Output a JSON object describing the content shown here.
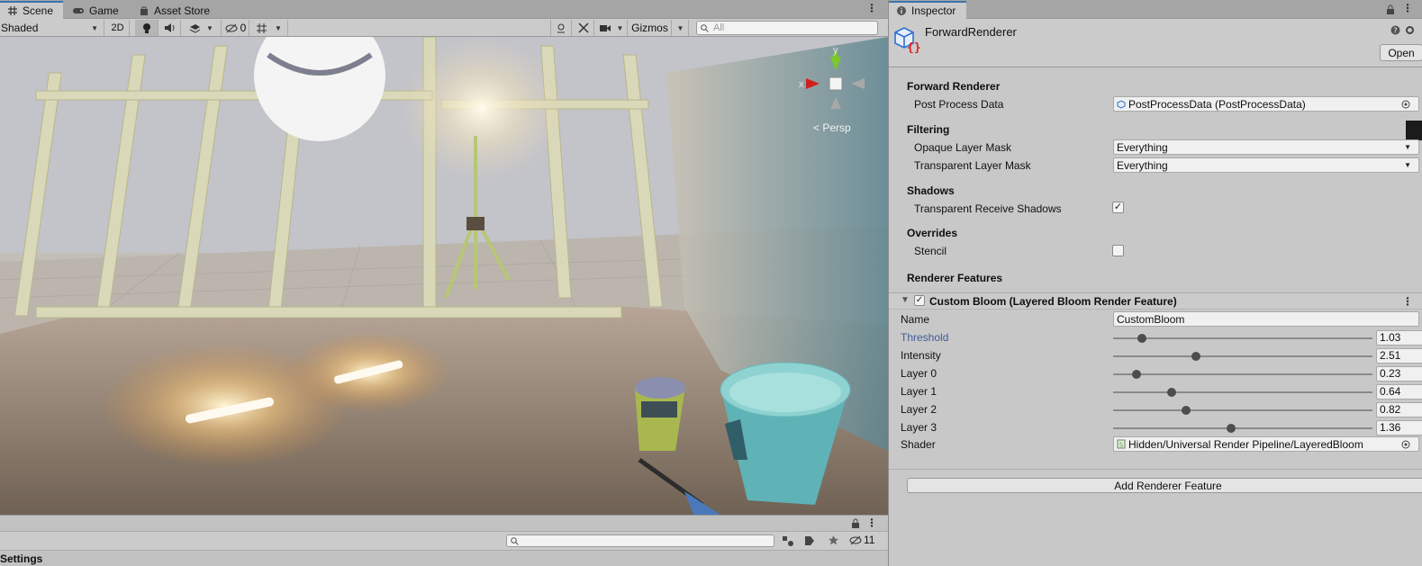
{
  "scene_window": {
    "tabs": [
      {
        "label": "Scene",
        "icon": "hash-icon",
        "active": true
      },
      {
        "label": "Game",
        "icon": "gamepad-icon",
        "active": false
      },
      {
        "label": "Asset Store",
        "icon": "bag-icon",
        "active": false
      }
    ],
    "toolbar": {
      "shading_mode": "Shaded",
      "mode_2d": "2D",
      "hidden_count": "0",
      "gizmos_label": "Gizmos",
      "search_placeholder": "All"
    },
    "viewport": {
      "gizmo_axis_y": "y",
      "gizmo_axis_x": "x",
      "projection_label": "< Persp"
    },
    "bottom": {
      "hidden_count": "11",
      "settings_label": "Settings"
    }
  },
  "inspector": {
    "tab_label": "Inspector",
    "asset_name": "ForwardRenderer",
    "open_button": "Open",
    "sections": {
      "forward_renderer": "Forward Renderer",
      "filtering": "Filtering",
      "shadows": "Shadows",
      "overrides": "Overrides",
      "renderer_features": "Renderer Features"
    },
    "props": {
      "post_process_label": "Post Process Data",
      "post_process_value": "PostProcessData (PostProcessData)",
      "opaque_mask_label": "Opaque Layer Mask",
      "opaque_mask_value": "Everything",
      "transparent_mask_label": "Transparent Layer Mask",
      "transparent_mask_value": "Everything",
      "transparent_shadows_label": "Transparent Receive Shadows",
      "transparent_shadows_checked": true,
      "stencil_label": "Stencil",
      "stencil_checked": false
    },
    "feature": {
      "title": "Custom Bloom (Layered Bloom Render Feature)",
      "enabled": true,
      "name_label": "Name",
      "name_value": "CustomBloom",
      "sliders": [
        {
          "label": "Threshold",
          "value": "1.03",
          "fraction": 0.11,
          "highlighted": true
        },
        {
          "label": "Intensity",
          "value": "2.51",
          "fraction": 0.32,
          "highlighted": false
        },
        {
          "label": "Layer 0",
          "value": "0.23",
          "fraction": 0.09,
          "highlighted": false
        },
        {
          "label": "Layer 1",
          "value": "0.64",
          "fraction": 0.225,
          "highlighted": false
        },
        {
          "label": "Layer 2",
          "value": "0.82",
          "fraction": 0.28,
          "highlighted": false
        },
        {
          "label": "Layer 3",
          "value": "1.36",
          "fraction": 0.455,
          "highlighted": false
        }
      ],
      "shader_label": "Shader",
      "shader_value": "Hidden/Universal Render Pipeline/LayeredBloom"
    },
    "add_feature_button": "Add Renderer Feature"
  },
  "colors": {
    "active_tab_accent": "#3a72b0",
    "link_label": "#3f5c9a"
  }
}
